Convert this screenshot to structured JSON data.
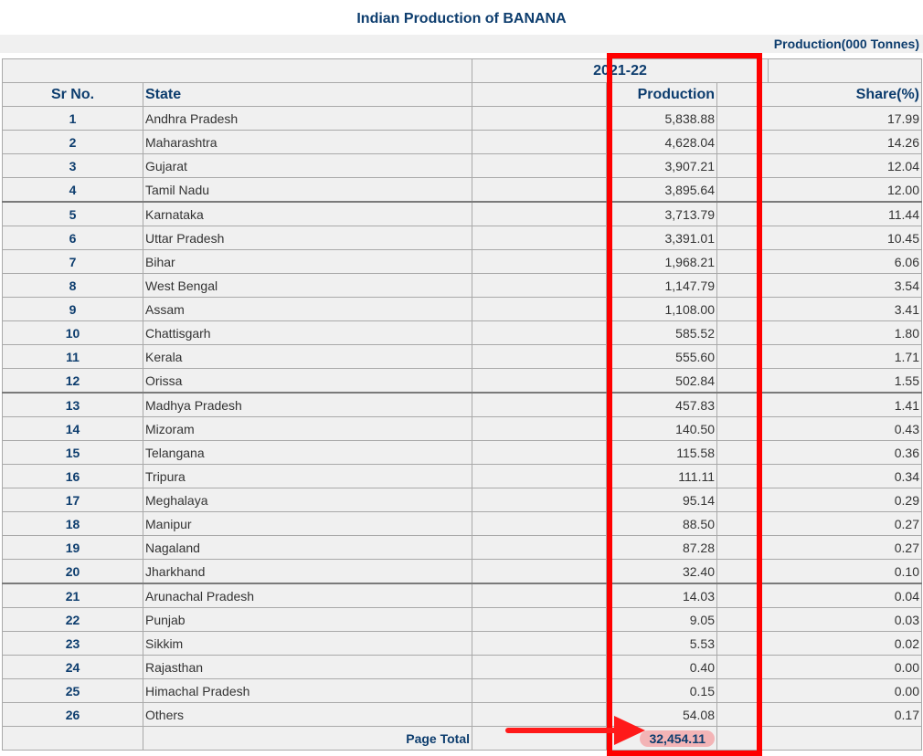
{
  "title": "Indian Production of BANANA",
  "unit": "Production(000 Tonnes)",
  "year": "2021-22",
  "headers": {
    "sr": "Sr No.",
    "state": "State",
    "production": "Production",
    "share": "Share(%)"
  },
  "rows": [
    {
      "sr": "1",
      "state": "Andhra Pradesh",
      "production": "5,838.88",
      "share": "17.99"
    },
    {
      "sr": "2",
      "state": "Maharashtra",
      "production": "4,628.04",
      "share": "14.26"
    },
    {
      "sr": "3",
      "state": "Gujarat",
      "production": "3,907.21",
      "share": "12.04"
    },
    {
      "sr": "4",
      "state": "Tamil Nadu",
      "production": "3,895.64",
      "share": "12.00"
    },
    {
      "sr": "5",
      "state": "Karnataka",
      "production": "3,713.79",
      "share": "11.44"
    },
    {
      "sr": "6",
      "state": "Uttar Pradesh",
      "production": "3,391.01",
      "share": "10.45"
    },
    {
      "sr": "7",
      "state": "Bihar",
      "production": "1,968.21",
      "share": "6.06"
    },
    {
      "sr": "8",
      "state": "West Bengal",
      "production": "1,147.79",
      "share": "3.54"
    },
    {
      "sr": "9",
      "state": "Assam",
      "production": "1,108.00",
      "share": "3.41"
    },
    {
      "sr": "10",
      "state": "Chattisgarh",
      "production": "585.52",
      "share": "1.80"
    },
    {
      "sr": "11",
      "state": "Kerala",
      "production": "555.60",
      "share": "1.71"
    },
    {
      "sr": "12",
      "state": "Orissa",
      "production": "502.84",
      "share": "1.55"
    },
    {
      "sr": "13",
      "state": "Madhya Pradesh",
      "production": "457.83",
      "share": "1.41"
    },
    {
      "sr": "14",
      "state": "Mizoram",
      "production": "140.50",
      "share": "0.43"
    },
    {
      "sr": "15",
      "state": "Telangana",
      "production": "115.58",
      "share": "0.36"
    },
    {
      "sr": "16",
      "state": "Tripura",
      "production": "111.11",
      "share": "0.34"
    },
    {
      "sr": "17",
      "state": "Meghalaya",
      "production": "95.14",
      "share": "0.29"
    },
    {
      "sr": "18",
      "state": "Manipur",
      "production": "88.50",
      "share": "0.27"
    },
    {
      "sr": "19",
      "state": "Nagaland",
      "production": "87.28",
      "share": "0.27"
    },
    {
      "sr": "20",
      "state": "Jharkhand",
      "production": "32.40",
      "share": "0.10"
    },
    {
      "sr": "21",
      "state": "Arunachal Pradesh",
      "production": "14.03",
      "share": "0.04"
    },
    {
      "sr": "22",
      "state": "Punjab",
      "production": "9.05",
      "share": "0.03"
    },
    {
      "sr": "23",
      "state": "Sikkim",
      "production": "5.53",
      "share": "0.02"
    },
    {
      "sr": "24",
      "state": "Rajasthan",
      "production": "0.40",
      "share": "0.00"
    },
    {
      "sr": "25",
      "state": "Himachal Pradesh",
      "production": "0.15",
      "share": "0.00"
    },
    {
      "sr": "26",
      "state": "Others",
      "production": "54.08",
      "share": "0.17"
    }
  ],
  "total": {
    "label": "Page Total",
    "production": "32,454.11"
  },
  "colors": {
    "header_text": "#0d3d6e",
    "highlight_box": "#ff0000",
    "total_highlight": "#f3b4b6"
  }
}
